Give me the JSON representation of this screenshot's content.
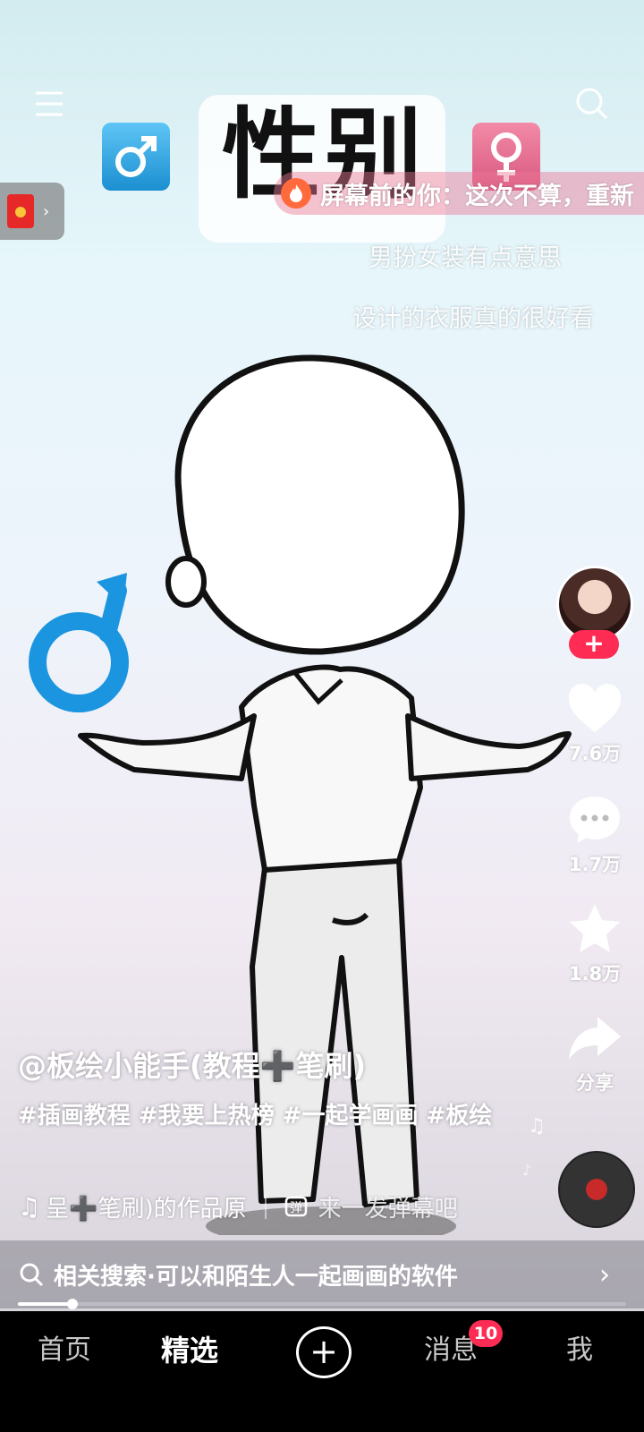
{
  "video": {
    "title_card_text": "性别",
    "male_symbol": "♂",
    "female_symbol": "♀"
  },
  "danmaku": {
    "hot": "屏幕前的你：这次不算，重新",
    "line1": "男扮女装有点意思",
    "line2": "设计的衣服真的很好看"
  },
  "rail": {
    "follow_label": "+",
    "likes": "7.6万",
    "comments": "1.7万",
    "favorites": "1.8万",
    "share": "分享"
  },
  "info": {
    "author": "@板绘小能手(教程➕笔刷)",
    "description": "#插画教程 #我要上热榜 #一起学画画 #板绘",
    "music": "呈➕笔刷)的作品原",
    "danmaku_placeholder": "来一发弹幕吧"
  },
  "related_search": {
    "text": "相关搜索·可以和陌生人一起画画的软件"
  },
  "progress": {
    "fraction": 0.09
  },
  "nav": {
    "home": "首页",
    "featured": "精选",
    "plus": "+",
    "messages": "消息",
    "messages_badge": "10",
    "me": "我"
  },
  "colors": {
    "accent": "#fe2c55",
    "male_blue": "#1b95e0"
  }
}
